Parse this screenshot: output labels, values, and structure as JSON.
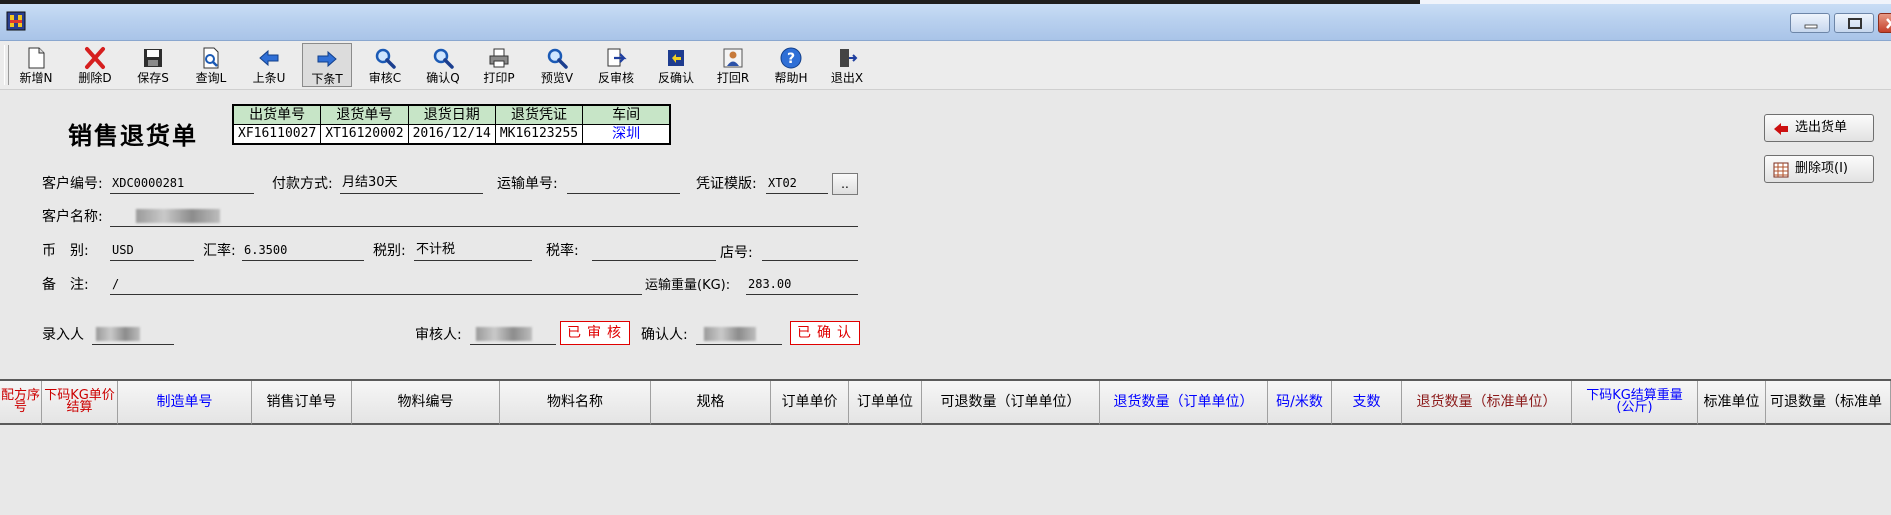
{
  "toolbar": {
    "buttons": [
      {
        "label": "新增N",
        "icon": "new-document-icon"
      },
      {
        "label": "删除D",
        "icon": "delete-x-icon"
      },
      {
        "label": "保存S",
        "icon": "save-disk-icon"
      },
      {
        "label": "查询L",
        "icon": "query-document-icon"
      },
      {
        "label": "上条U",
        "icon": "arrow-left-icon"
      },
      {
        "label": "下条T",
        "icon": "arrow-right-icon"
      },
      {
        "label": "审核C",
        "icon": "magnifier-icon"
      },
      {
        "label": "确认Q",
        "icon": "magnifier-icon"
      },
      {
        "label": "打印P",
        "icon": "printer-icon"
      },
      {
        "label": "预览V",
        "icon": "magnifier-icon"
      },
      {
        "label": "反审核",
        "icon": "undo-document-icon"
      },
      {
        "label": "反确认",
        "icon": "undo-confirm-icon"
      },
      {
        "label": "打回R",
        "icon": "return-person-icon"
      },
      {
        "label": "帮助H",
        "icon": "help-icon"
      },
      {
        "label": "退出X",
        "icon": "exit-door-icon"
      }
    ]
  },
  "form": {
    "title": "销售退货单",
    "header_table": {
      "columns": [
        "出货单号",
        "退货单号",
        "退货日期",
        "退货凭证",
        "车间"
      ],
      "values": [
        "XF16110027",
        "XT16120002",
        "2016/12/14",
        "MK16123255",
        "深圳"
      ]
    },
    "side_buttons": {
      "select_shipment": "选出货单",
      "delete_item": "删除项(I)"
    },
    "fields": {
      "customer_no_label": "客户编号:",
      "customer_no": "XDC0000281",
      "payment_label": "付款方式:",
      "payment": "月结30天",
      "transport_no_label": "运输单号:",
      "transport_no": "",
      "voucher_template_label": "凭证模版:",
      "voucher_template": "XT02",
      "dots_button": "..",
      "customer_name_label": "客户名称:",
      "currency_label": "币　别:",
      "currency": "USD",
      "exchange_rate_label": "汇率:",
      "exchange_rate": "6.3500",
      "tax_type_label": "税别:",
      "tax_type": "不计税",
      "tax_rate_label": "税率:",
      "tax_rate": "",
      "store_no_label": "店号:",
      "store_no": "",
      "remark_label": "备　注:",
      "remark": "/",
      "transport_weight_label": "运输重量(KG):",
      "transport_weight": "283.00",
      "entered_by_label": "录入人",
      "auditor_label": "审核人:",
      "audited_stamp": "已审核",
      "confirmer_label": "确认人:",
      "confirmed_stamp": "已确认"
    }
  },
  "grid": {
    "columns": [
      {
        "label": "配方序号",
        "color": "#cc0000"
      },
      {
        "label": "下码KG单价结算",
        "color": "#cc0000"
      },
      {
        "label": "制造单号",
        "color": "#0000ff"
      },
      {
        "label": "销售订单号",
        "color": "#000000"
      },
      {
        "label": "物料编号",
        "color": "#000000"
      },
      {
        "label": "物料名称",
        "color": "#000000"
      },
      {
        "label": "规格",
        "color": "#000000"
      },
      {
        "label": "订单单价",
        "color": "#000000"
      },
      {
        "label": "订单单位",
        "color": "#000000"
      },
      {
        "label": "可退数量（订单单位）",
        "color": "#000000"
      },
      {
        "label": "退货数量（订单单位）",
        "color": "#0000ff"
      },
      {
        "label": "码/米数",
        "color": "#0000ff"
      },
      {
        "label": "支数",
        "color": "#0000ff"
      },
      {
        "label": "退货数量（标准单位）",
        "color": "#8b1a1a"
      },
      {
        "label": "下码KG结算重量(公斤)",
        "color": "#0000ff"
      },
      {
        "label": "标准单位",
        "color": "#000000"
      },
      {
        "label": "可退数量（标准单",
        "color": "#000000"
      }
    ]
  }
}
